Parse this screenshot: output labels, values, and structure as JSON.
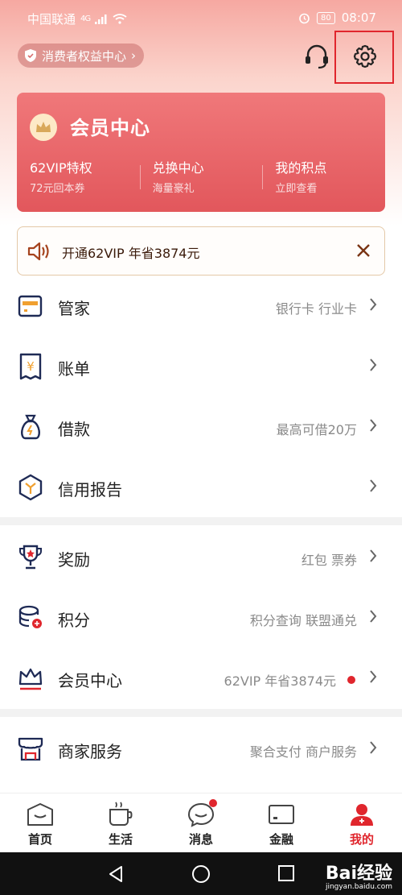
{
  "status_bar": {
    "carrier": "中国联通",
    "network": "4G",
    "battery": "80",
    "time": "08:07"
  },
  "top": {
    "rights_label": "消费者权益中心"
  },
  "member_card": {
    "title": "会员中心",
    "benefits": [
      {
        "title": "62VIP特权",
        "subtitle": "72元回本券"
      },
      {
        "title": "兑换中心",
        "subtitle": "海量豪礼"
      },
      {
        "title": "我的积点",
        "subtitle": "立即查看"
      }
    ]
  },
  "promo": {
    "text": "开通62VIP 年省3874元"
  },
  "menu": [
    {
      "label": "管家",
      "value": "银行卡 行业卡",
      "icon": "wallet-icon"
    },
    {
      "label": "账单",
      "value": "",
      "icon": "bill-icon"
    },
    {
      "label": "借款",
      "value": "最高可借20万",
      "icon": "money-bag-icon"
    },
    {
      "label": "信用报告",
      "value": "",
      "icon": "credit-report-icon"
    },
    {
      "label": "奖励",
      "value": "红包 票券",
      "icon": "trophy-icon"
    },
    {
      "label": "积分",
      "value": "积分查询 联盟通兑",
      "icon": "coins-icon"
    },
    {
      "label": "会员中心",
      "value": "62VIP 年省3874元",
      "icon": "crown-icon",
      "dot": true
    },
    {
      "label": "商家服务",
      "value": "聚合支付 商户服务",
      "icon": "shop-icon"
    }
  ],
  "bottom_nav": [
    {
      "label": "首页",
      "icon": "home-icon"
    },
    {
      "label": "生活",
      "icon": "cup-icon"
    },
    {
      "label": "消息",
      "icon": "message-icon",
      "dot": true
    },
    {
      "label": "金融",
      "icon": "card-icon"
    },
    {
      "label": "我的",
      "icon": "person-icon",
      "active": true
    }
  ],
  "watermark": {
    "text": "Bai经验",
    "sub": "jingyan.baidu.com"
  },
  "colors": {
    "accent": "#e0262d",
    "card": "#e8656a",
    "icon_navy": "#1e2a55"
  }
}
